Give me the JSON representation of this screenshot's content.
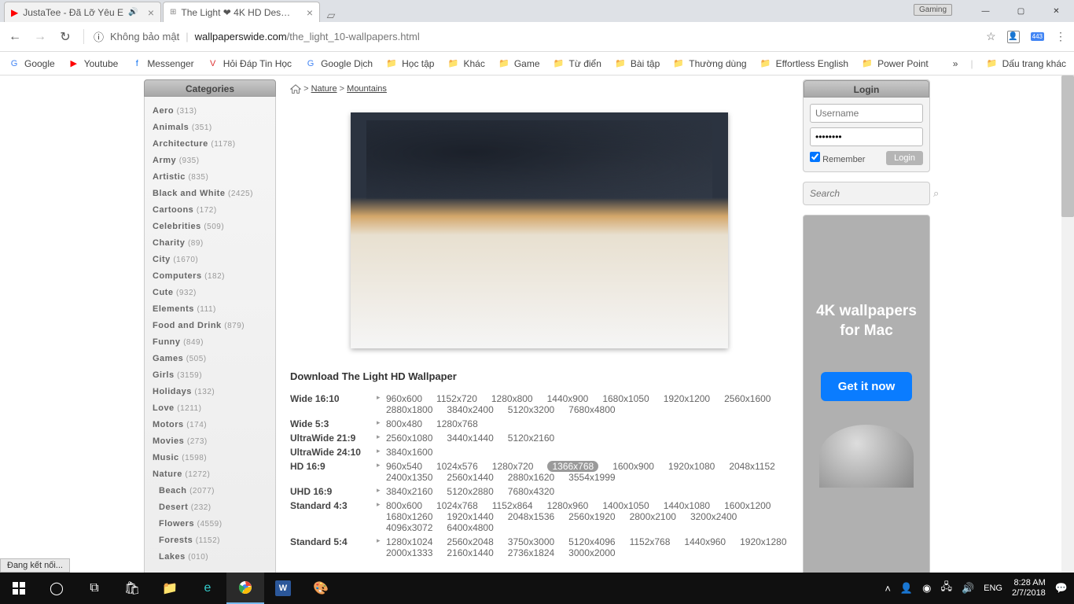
{
  "browser": {
    "tabs": [
      {
        "title": "JustaTee - Đã Lỡ Yêu E",
        "active": false,
        "audio": true
      },
      {
        "title": "The Light ❤ 4K HD Des…",
        "active": true,
        "audio": false
      }
    ],
    "gaming_badge": "Gaming",
    "win": {
      "min": "—",
      "max": "▢",
      "close": "✕"
    },
    "nav": {
      "back": "←",
      "forward": "→",
      "reload": "↻"
    },
    "url": {
      "insecure_icon": "ⓘ",
      "insecure_label": "Không bảo mật",
      "host": "wallpaperswide.com",
      "path": "/the_light_10-wallpapers.html"
    },
    "addr_icons": {
      "bookmark": "☆",
      "user": "👤",
      "ext_badge": "443"
    },
    "bookmarks": [
      {
        "ico": "G",
        "label": "Google",
        "color": "#4285f4"
      },
      {
        "ico": "▶",
        "label": "Youtube",
        "color": "#ff0000"
      },
      {
        "ico": "f",
        "label": "Messenger",
        "color": "#1877f2"
      },
      {
        "ico": "V",
        "label": "Hỏi Đáp Tin Học",
        "color": "#d33"
      },
      {
        "ico": "G",
        "label": "Google Dịch",
        "color": "#4285f4"
      },
      {
        "ico": "📁",
        "label": "Học tập",
        "folder": true
      },
      {
        "ico": "📁",
        "label": "Khác",
        "folder": true
      },
      {
        "ico": "📁",
        "label": "Game",
        "folder": true
      },
      {
        "ico": "📁",
        "label": "Từ điển",
        "folder": true
      },
      {
        "ico": "📁",
        "label": "Bài tập",
        "folder": true
      },
      {
        "ico": "📁",
        "label": "Thường dùng",
        "folder": true
      },
      {
        "ico": "📁",
        "label": "Effortless English",
        "folder": true
      },
      {
        "ico": "📁",
        "label": "Power Point",
        "folder": true
      }
    ],
    "bm_more": "»",
    "bm_other": "Dấu trang khác"
  },
  "sidebar": {
    "title": "Categories",
    "items": [
      {
        "name": "Aero",
        "count": "(313)"
      },
      {
        "name": "Animals",
        "count": "(351)"
      },
      {
        "name": "Architecture",
        "count": "(1178)"
      },
      {
        "name": "Army",
        "count": "(935)"
      },
      {
        "name": "Artistic",
        "count": "(835)"
      },
      {
        "name": "Black and White",
        "count": "(2425)"
      },
      {
        "name": "Cartoons",
        "count": "(172)"
      },
      {
        "name": "Celebrities",
        "count": "(509)"
      },
      {
        "name": "Charity",
        "count": "(89)"
      },
      {
        "name": "City",
        "count": "(1670)"
      },
      {
        "name": "Computers",
        "count": "(182)"
      },
      {
        "name": "Cute",
        "count": "(932)"
      },
      {
        "name": "Elements",
        "count": "(111)"
      },
      {
        "name": "Food and Drink",
        "count": "(879)"
      },
      {
        "name": "Funny",
        "count": "(849)"
      },
      {
        "name": "Games",
        "count": "(505)"
      },
      {
        "name": "Girls",
        "count": "(3159)"
      },
      {
        "name": "Holidays",
        "count": "(132)"
      },
      {
        "name": "Love",
        "count": "(1211)"
      },
      {
        "name": "Motors",
        "count": "(174)"
      },
      {
        "name": "Movies",
        "count": "(273)"
      },
      {
        "name": "Music",
        "count": "(1598)"
      },
      {
        "name": "Nature",
        "count": "(1272)"
      },
      {
        "name": "Beach",
        "count": "(2077)",
        "sub": true
      },
      {
        "name": "Desert",
        "count": "(232)",
        "sub": true
      },
      {
        "name": "Flowers",
        "count": "(4559)",
        "sub": true
      },
      {
        "name": "Forests",
        "count": "(1152)",
        "sub": true
      },
      {
        "name": "Lakes",
        "count": "(010)",
        "sub": true
      }
    ]
  },
  "breadcrumb": {
    "l1": "Nature",
    "l2": "Mountains",
    "sep": ">"
  },
  "download_title": "Download The Light HD Wallpaper",
  "resolutions": [
    {
      "label": "Wide 16:10",
      "values": [
        "960x600",
        "1152x720",
        "1280x800",
        "1440x900",
        "1680x1050",
        "1920x1200",
        "2560x1600",
        "2880x1800",
        "3840x2400",
        "5120x3200",
        "7680x4800"
      ]
    },
    {
      "label": "Wide 5:3",
      "values": [
        "800x480",
        "1280x768"
      ]
    },
    {
      "label": "UltraWide 21:9",
      "values": [
        "2560x1080",
        "3440x1440",
        "5120x2160"
      ]
    },
    {
      "label": "UltraWide 24:10",
      "values": [
        "3840x1600"
      ]
    },
    {
      "label": "HD 16:9",
      "values": [
        "960x540",
        "1024x576",
        "1280x720",
        "1366x768",
        "1600x900",
        "1920x1080",
        "2048x1152",
        "2400x1350",
        "2560x1440",
        "2880x1620",
        "3554x1999"
      ],
      "active": "1366x768"
    },
    {
      "label": "UHD 16:9",
      "values": [
        "3840x2160",
        "5120x2880",
        "7680x4320"
      ]
    },
    {
      "label": "Standard 4:3",
      "values": [
        "800x600",
        "1024x768",
        "1152x864",
        "1280x960",
        "1400x1050",
        "1440x1080",
        "1600x1200",
        "1680x1260",
        "1920x1440",
        "2048x1536",
        "2560x1920",
        "2800x2100",
        "3200x2400",
        "4096x3072",
        "6400x4800"
      ]
    },
    {
      "label": "Standard 5:4",
      "values": [
        "1280x1024",
        "2560x2048",
        "3750x3000",
        "5120x4096",
        "1152x768",
        "1440x960",
        "1920x1280",
        "2000x1333",
        "2160x1440",
        "2736x1824",
        "3000x2000"
      ]
    }
  ],
  "login": {
    "title": "Login",
    "user_placeholder": "Username",
    "pass_value": "••••••••",
    "remember": "Remember",
    "btn": "Login"
  },
  "search": {
    "placeholder": "Search"
  },
  "ad": {
    "line1": "4K wallpapers",
    "line2": "for Mac",
    "btn": "Get it now"
  },
  "status": "Đang kết nối...",
  "tray": {
    "lang": "ENG",
    "time": "8:28 AM",
    "date": "2/7/2018"
  }
}
